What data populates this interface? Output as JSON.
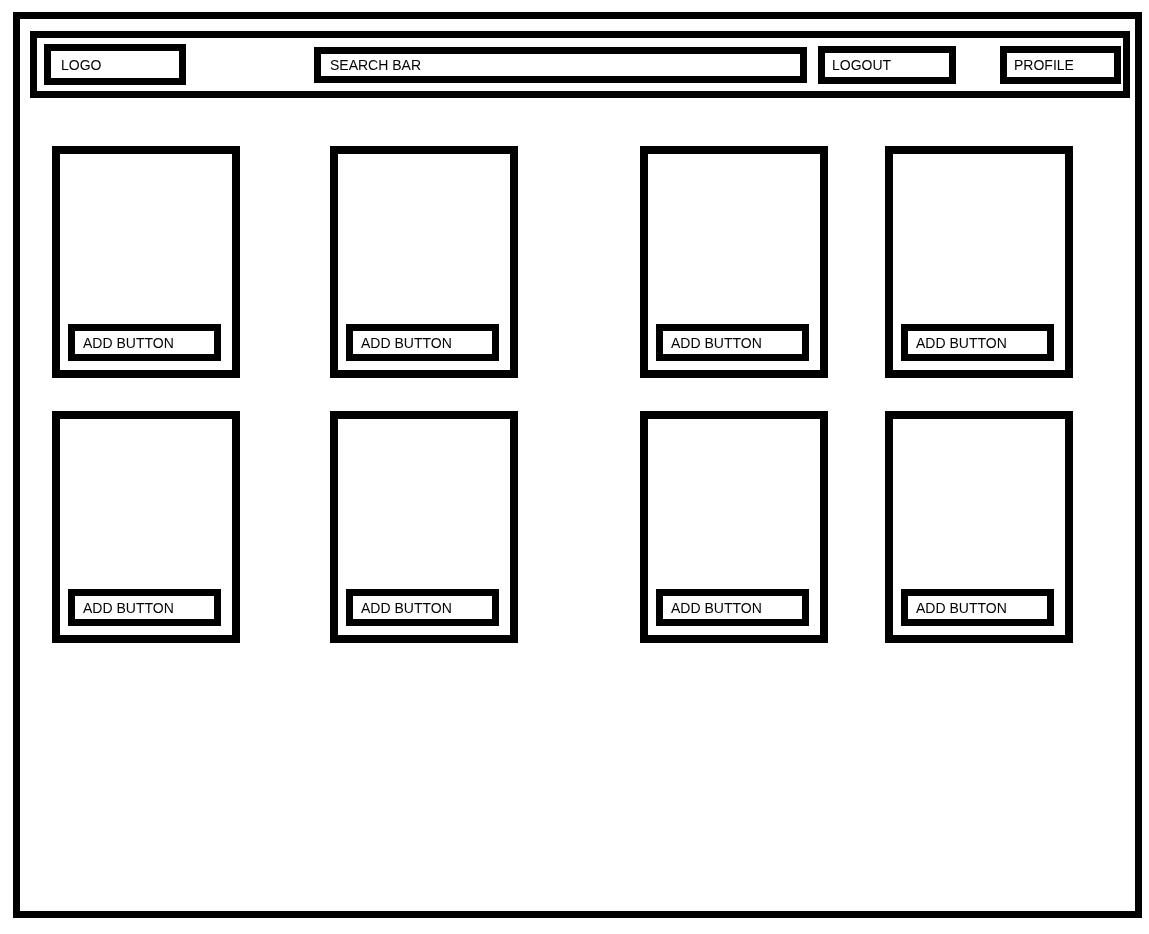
{
  "header": {
    "logo": "LOGO",
    "search": {
      "placeholder": "SEARCH BAR"
    },
    "buttons": [
      "LOGOUT",
      "PROFILE"
    ]
  },
  "cards": [
    {
      "button": "ADD BUTTON"
    },
    {
      "button": "ADD BUTTON"
    },
    {
      "button": "ADD BUTTON"
    },
    {
      "button": "ADD BUTTON"
    },
    {
      "button": "ADD BUTTON"
    },
    {
      "button": "ADD BUTTON"
    },
    {
      "button": "ADD BUTTON"
    },
    {
      "button": "ADD BUTTON"
    }
  ]
}
